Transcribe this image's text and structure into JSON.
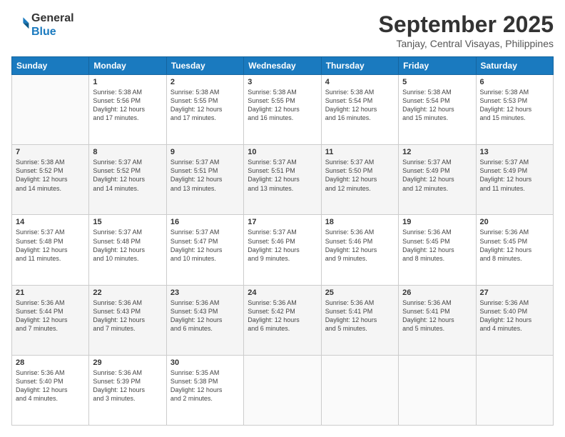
{
  "header": {
    "logo_line1": "General",
    "logo_line2": "Blue",
    "month_title": "September 2025",
    "location": "Tanjay, Central Visayas, Philippines"
  },
  "days_of_week": [
    "Sunday",
    "Monday",
    "Tuesday",
    "Wednesday",
    "Thursday",
    "Friday",
    "Saturday"
  ],
  "weeks": [
    [
      {
        "day": "",
        "info": ""
      },
      {
        "day": "1",
        "info": "Sunrise: 5:38 AM\nSunset: 5:56 PM\nDaylight: 12 hours\nand 17 minutes."
      },
      {
        "day": "2",
        "info": "Sunrise: 5:38 AM\nSunset: 5:55 PM\nDaylight: 12 hours\nand 17 minutes."
      },
      {
        "day": "3",
        "info": "Sunrise: 5:38 AM\nSunset: 5:55 PM\nDaylight: 12 hours\nand 16 minutes."
      },
      {
        "day": "4",
        "info": "Sunrise: 5:38 AM\nSunset: 5:54 PM\nDaylight: 12 hours\nand 16 minutes."
      },
      {
        "day": "5",
        "info": "Sunrise: 5:38 AM\nSunset: 5:54 PM\nDaylight: 12 hours\nand 15 minutes."
      },
      {
        "day": "6",
        "info": "Sunrise: 5:38 AM\nSunset: 5:53 PM\nDaylight: 12 hours\nand 15 minutes."
      }
    ],
    [
      {
        "day": "7",
        "info": "Sunrise: 5:38 AM\nSunset: 5:52 PM\nDaylight: 12 hours\nand 14 minutes."
      },
      {
        "day": "8",
        "info": "Sunrise: 5:37 AM\nSunset: 5:52 PM\nDaylight: 12 hours\nand 14 minutes."
      },
      {
        "day": "9",
        "info": "Sunrise: 5:37 AM\nSunset: 5:51 PM\nDaylight: 12 hours\nand 13 minutes."
      },
      {
        "day": "10",
        "info": "Sunrise: 5:37 AM\nSunset: 5:51 PM\nDaylight: 12 hours\nand 13 minutes."
      },
      {
        "day": "11",
        "info": "Sunrise: 5:37 AM\nSunset: 5:50 PM\nDaylight: 12 hours\nand 12 minutes."
      },
      {
        "day": "12",
        "info": "Sunrise: 5:37 AM\nSunset: 5:49 PM\nDaylight: 12 hours\nand 12 minutes."
      },
      {
        "day": "13",
        "info": "Sunrise: 5:37 AM\nSunset: 5:49 PM\nDaylight: 12 hours\nand 11 minutes."
      }
    ],
    [
      {
        "day": "14",
        "info": "Sunrise: 5:37 AM\nSunset: 5:48 PM\nDaylight: 12 hours\nand 11 minutes."
      },
      {
        "day": "15",
        "info": "Sunrise: 5:37 AM\nSunset: 5:48 PM\nDaylight: 12 hours\nand 10 minutes."
      },
      {
        "day": "16",
        "info": "Sunrise: 5:37 AM\nSunset: 5:47 PM\nDaylight: 12 hours\nand 10 minutes."
      },
      {
        "day": "17",
        "info": "Sunrise: 5:37 AM\nSunset: 5:46 PM\nDaylight: 12 hours\nand 9 minutes."
      },
      {
        "day": "18",
        "info": "Sunrise: 5:36 AM\nSunset: 5:46 PM\nDaylight: 12 hours\nand 9 minutes."
      },
      {
        "day": "19",
        "info": "Sunrise: 5:36 AM\nSunset: 5:45 PM\nDaylight: 12 hours\nand 8 minutes."
      },
      {
        "day": "20",
        "info": "Sunrise: 5:36 AM\nSunset: 5:45 PM\nDaylight: 12 hours\nand 8 minutes."
      }
    ],
    [
      {
        "day": "21",
        "info": "Sunrise: 5:36 AM\nSunset: 5:44 PM\nDaylight: 12 hours\nand 7 minutes."
      },
      {
        "day": "22",
        "info": "Sunrise: 5:36 AM\nSunset: 5:43 PM\nDaylight: 12 hours\nand 7 minutes."
      },
      {
        "day": "23",
        "info": "Sunrise: 5:36 AM\nSunset: 5:43 PM\nDaylight: 12 hours\nand 6 minutes."
      },
      {
        "day": "24",
        "info": "Sunrise: 5:36 AM\nSunset: 5:42 PM\nDaylight: 12 hours\nand 6 minutes."
      },
      {
        "day": "25",
        "info": "Sunrise: 5:36 AM\nSunset: 5:41 PM\nDaylight: 12 hours\nand 5 minutes."
      },
      {
        "day": "26",
        "info": "Sunrise: 5:36 AM\nSunset: 5:41 PM\nDaylight: 12 hours\nand 5 minutes."
      },
      {
        "day": "27",
        "info": "Sunrise: 5:36 AM\nSunset: 5:40 PM\nDaylight: 12 hours\nand 4 minutes."
      }
    ],
    [
      {
        "day": "28",
        "info": "Sunrise: 5:36 AM\nSunset: 5:40 PM\nDaylight: 12 hours\nand 4 minutes."
      },
      {
        "day": "29",
        "info": "Sunrise: 5:36 AM\nSunset: 5:39 PM\nDaylight: 12 hours\nand 3 minutes."
      },
      {
        "day": "30",
        "info": "Sunrise: 5:35 AM\nSunset: 5:38 PM\nDaylight: 12 hours\nand 2 minutes."
      },
      {
        "day": "",
        "info": ""
      },
      {
        "day": "",
        "info": ""
      },
      {
        "day": "",
        "info": ""
      },
      {
        "day": "",
        "info": ""
      }
    ]
  ]
}
